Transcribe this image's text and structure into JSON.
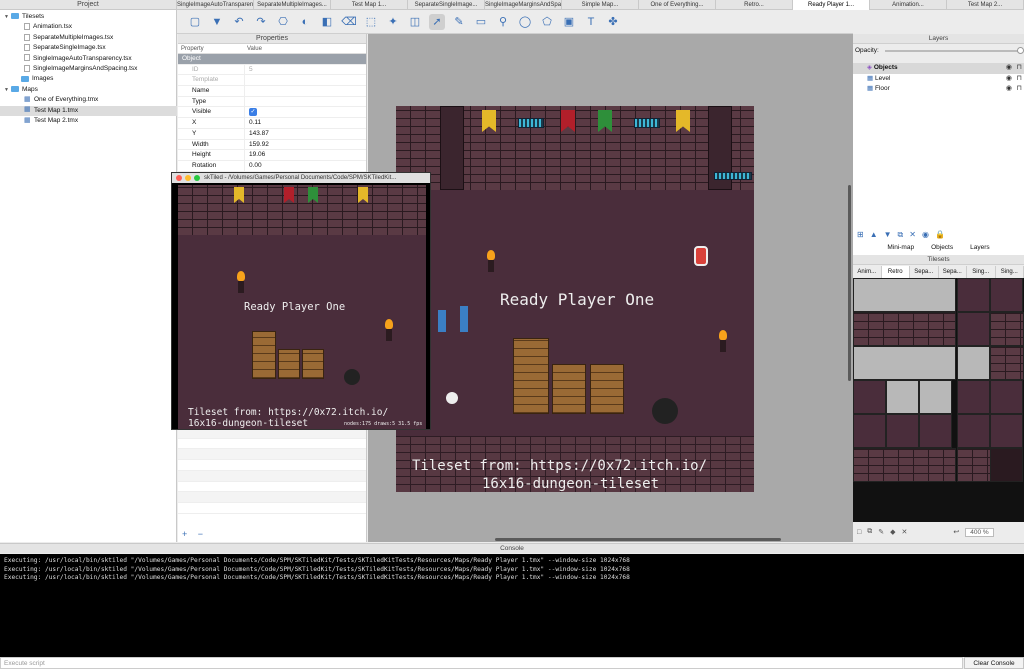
{
  "project_panel": {
    "title": "Project",
    "tree": [
      {
        "label": "Tilesets",
        "kind": "folder",
        "expanded": true,
        "indent": 0
      },
      {
        "label": "Animation.tsx",
        "kind": "file",
        "indent": 2
      },
      {
        "label": "SeparateMultipleImages.tsx",
        "kind": "file",
        "indent": 2
      },
      {
        "label": "SeparateSingleImage.tsx",
        "kind": "file",
        "indent": 2
      },
      {
        "label": "SingleImageAutoTransparency.tsx",
        "kind": "file",
        "indent": 2
      },
      {
        "label": "SingleImageMarginsAndSpacing.tsx",
        "kind": "file",
        "indent": 2
      },
      {
        "label": "Images",
        "kind": "folder",
        "indent": 1
      },
      {
        "label": "Maps",
        "kind": "folder",
        "expanded": true,
        "indent": 0
      },
      {
        "label": "One of Everything.tmx",
        "kind": "tmx",
        "indent": 2
      },
      {
        "label": "Test Map 1.tmx",
        "kind": "tmx",
        "indent": 2,
        "selected": true
      },
      {
        "label": "Test Map 2.tmx",
        "kind": "tmx",
        "indent": 2
      }
    ]
  },
  "tabs": [
    {
      "label": "SingleImageAutoTransparency..."
    },
    {
      "label": "SeparateMultipleImages..."
    },
    {
      "label": "Test Map 1..."
    },
    {
      "label": "SeparateSingleImage..."
    },
    {
      "label": "SingleImageMarginsAndSpacing..."
    },
    {
      "label": "Simple Map..."
    },
    {
      "label": "One of Everything..."
    },
    {
      "label": "Retro..."
    },
    {
      "label": "Ready Player 1...",
      "active": true
    },
    {
      "label": "Animation..."
    },
    {
      "label": "Test Map 2..."
    }
  ],
  "toolbar": {
    "icons": [
      "new-file-icon",
      "save-icon",
      "undo-icon",
      "redo-icon",
      "stamp-icon",
      "terrain-icon",
      "fill-icon",
      "eraser-icon",
      "rect-select-icon",
      "magic-wand-icon",
      "select-same-icon",
      "object-select-icon",
      "edit-polygon-icon",
      "insert-rect-icon",
      "insert-point-icon",
      "insert-ellipse-icon",
      "insert-polygon-icon",
      "insert-tile-icon",
      "insert-text-icon",
      "more-icon"
    ]
  },
  "properties": {
    "title": "Properties",
    "col_property": "Property",
    "col_value": "Value",
    "group": "Object",
    "rows": [
      {
        "key": "ID",
        "value": "5",
        "dim": true
      },
      {
        "key": "Template",
        "value": "",
        "dim": true
      },
      {
        "key": "Name",
        "value": ""
      },
      {
        "key": "Type",
        "value": ""
      },
      {
        "key": "Visible",
        "value": "✓"
      },
      {
        "key": "X",
        "value": "0.11"
      },
      {
        "key": "Y",
        "value": "143.87"
      },
      {
        "key": "Width",
        "value": "159.92"
      },
      {
        "key": "Height",
        "value": "19.06"
      },
      {
        "key": "Rotation",
        "value": "0.00"
      }
    ],
    "footer_add": "+",
    "footer_remove": "−"
  },
  "map": {
    "title_text": "Ready Player One",
    "credit_line1": "Tileset from: https://0x72.itch.io/",
    "credit_line2": "16x16-dungeon-tileset"
  },
  "game_window": {
    "title": "skTiled - /Volumes/Games/Personal Documents/Code/SPM/SKTiledKit...",
    "title_text": "Ready Player One",
    "credit_line1": "Tileset from: https://0x72.itch.io/",
    "credit_line2": "16x16-dungeon-tileset",
    "stats": "nodes:175  draws:5   31.5 fps"
  },
  "layers_panel": {
    "title": "Layers",
    "opacity_label": "Opacity:",
    "layers": [
      {
        "name": "Objects",
        "selected": true
      },
      {
        "name": "Level"
      },
      {
        "name": "Floor"
      }
    ],
    "subtabs": [
      "Mini-map",
      "Objects",
      "Layers"
    ]
  },
  "tilesets_panel": {
    "title": "Tilesets",
    "tabs": [
      "Anim...",
      "Retro",
      "Sepa...",
      "Sepa...",
      "Sing...",
      "Sing..."
    ],
    "zoom": "400 %"
  },
  "console": {
    "title": "Console",
    "lines": [
      "Executing: /usr/local/bin/sktiled \"/Volumes/Games/Personal Documents/Code/SPM/SKTiledKit/Tests/SKTiledKitTests/Resources/Maps/Ready Player 1.tmx\" --window-size 1024x768",
      "Executing: /usr/local/bin/sktiled \"/Volumes/Games/Personal Documents/Code/SPM/SKTiledKit/Tests/SKTiledKitTests/Resources/Maps/Ready Player 1.tmx\" --window-size 1024x768",
      "Executing: /usr/local/bin/sktiled \"/Volumes/Games/Personal Documents/Code/SPM/SKTiledKit/Tests/SKTiledKitTests/Resources/Maps/Ready Player 1.tmx\" --window-size 1024x768"
    ],
    "execute_placeholder": "Execute script",
    "clear_label": "Clear Console"
  }
}
